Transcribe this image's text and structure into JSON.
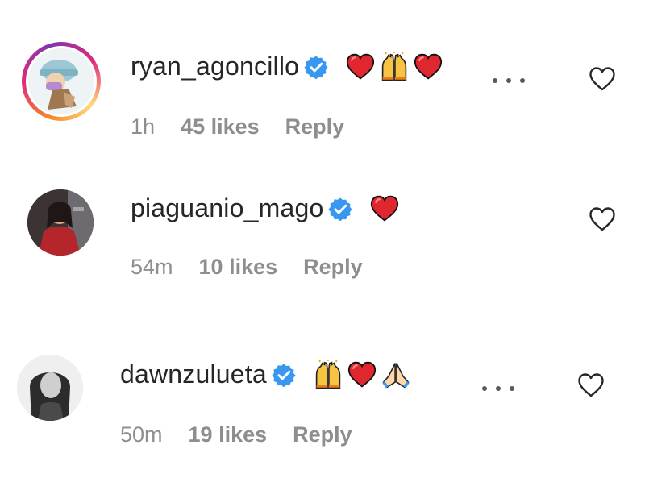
{
  "comments": [
    {
      "username": "ryan_agoncillo",
      "emoji_text": "❤️🙌❤️",
      "time": "1h",
      "likes": "45 likes",
      "reply": "Reply"
    },
    {
      "username": "piaguanio_mago",
      "emoji_text": "❤️",
      "time": "54m",
      "likes": "10 likes",
      "reply": "Reply"
    },
    {
      "username": "dawnzulueta",
      "emoji_text": "🙌❤️🙏",
      "time": "50m",
      "likes": "19 likes",
      "reply": "Reply"
    }
  ],
  "colors": {
    "verified": "#3897f0",
    "heart_red": "#e0262f",
    "text": "#262626",
    "meta": "#8e8e8e"
  },
  "icons": [
    "verified-badge-icon",
    "red-heart-emoji",
    "raising-hands-emoji",
    "folded-hands-emoji",
    "more-options-icon",
    "like-heart-icon"
  ]
}
